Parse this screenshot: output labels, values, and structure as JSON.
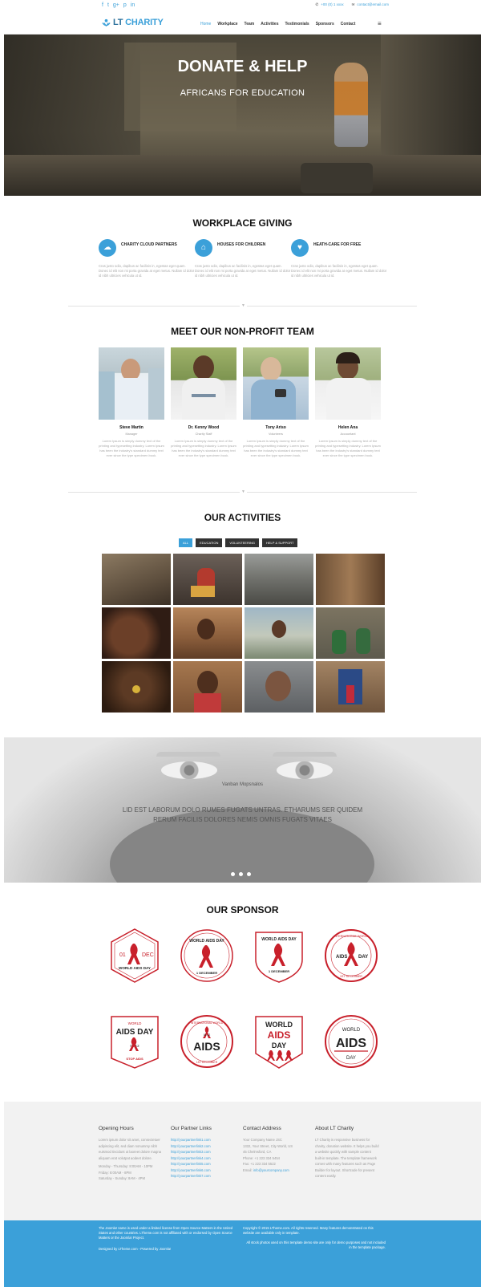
{
  "topbar": {
    "social_icons": [
      "facebook-icon",
      "twitter-icon",
      "google-plus-icon",
      "pinterest-icon",
      "linkedin-icon"
    ],
    "phone": "+00 (0) 1 xxxx",
    "email": "contact@email.com"
  },
  "header": {
    "logo_lt": "LT",
    "logo_charity": "CHARITY",
    "nav": [
      "Home",
      "Workplace",
      "Team",
      "Activities",
      "Testimonials",
      "Sponsors",
      "Contact"
    ]
  },
  "hero": {
    "title": "DONATE & HELP",
    "subtitle": "AFRICANS FOR EDUCATION"
  },
  "workplace": {
    "title": "WORKPLACE GIVING",
    "items": [
      {
        "heading": "CHARITY CLOUD PARTNERS",
        "icon": "cloud-icon",
        "text": "Cras justo odio, dapibus ac facilisis in, egestas eget quam. Donec id elit non mi porta gravida at eget metus. Nullam id dolor id nibh ultricies vehicula ut id."
      },
      {
        "heading": "HOUSES FOR CHILDREN",
        "icon": "home-icon",
        "text": "Cras justo odio, dapibus ac facilisis in, egestas eget quam. Donec id elit non mi porta gravida at eget metus. Nullam id dolor id nibh ultricies vehicula ut id."
      },
      {
        "heading": "HEATH-CARE FOR FREE",
        "icon": "heart-icon",
        "text": "Cras justo odio, dapibus ac facilisis in, egestas eget quam. Donec id elit non mi porta gravida at eget metus. Nullam id dolor id nibh ultricies vehicula ut id."
      }
    ]
  },
  "team": {
    "title": "MEET OUR NON-PROFIT TEAM",
    "members": [
      {
        "name": "Steve Martin",
        "role": "Manager",
        "bio": "Lorem Ipsum is simply dummy text of the printing and typesetting industry. Lorem Ipsum has been the industry's standard dummy text ever since the type specimen book."
      },
      {
        "name": "Dr. Kenny Wood",
        "role": "Charity Staff",
        "bio": "Lorem Ipsum is simply dummy text of the printing and typesetting industry. Lorem Ipsum has been the industry's standard dummy text ever since the type specimen book."
      },
      {
        "name": "Tony Ariso",
        "role": "Volunteers",
        "bio": "Lorem Ipsum is simply dummy text of the printing and typesetting industry. Lorem Ipsum has been the industry's standard dummy text ever since the type specimen book."
      },
      {
        "name": "Helen Ana",
        "role": "Accountant",
        "bio": "Lorem Ipsum is simply dummy text of the printing and typesetting industry. Lorem Ipsum has been the industry's standard dummy text ever since the type specimen book."
      }
    ]
  },
  "activities": {
    "title": "OUR ACTIVITIES",
    "filters": [
      "ALL",
      "EDUCATION",
      "VOLUNTEERING",
      "HELP & SUPPORT"
    ],
    "gallery_count": 12
  },
  "testimonial": {
    "author": "Vanban Mopsnalos",
    "quote": "LID EST LABORUM DOLO RUMES FUGATS UNTRAS. ETHARUMS SER QUIDEM RERUM FACILIS DOLORES NEMIS OMNIS FUGATS VITAES"
  },
  "sponsors": {
    "title": "OUR SPONSOR",
    "badges": [
      {
        "line1": "01",
        "line2": "DEC",
        "line3": "WORLD AIDS DAY"
      },
      {
        "line1": "WORLD AIDS DAY",
        "line2": "1 DECEMBER"
      },
      {
        "line1": "WORLD AIDS DAY",
        "line2": "1 DECEMBER"
      },
      {
        "line1": "AIDS",
        "line2": "DAY",
        "line3": "1ST DECEMBER",
        "line4": "INTERNATIONAL WORLD"
      },
      {
        "line1": "WORLD",
        "line2": "AIDS DAY",
        "line3": "01 12",
        "line4": "STOP AIDS"
      },
      {
        "line1": "AIDS",
        "line2": "INTERNATIONAL WORLD",
        "line3": "1ST DECEMBER",
        "line4": "01 12"
      },
      {
        "line1": "WORLD",
        "line2": "AIDS",
        "line3": "DAY"
      },
      {
        "line1": "WORLD",
        "line2": "AIDS",
        "line3": "DAY"
      }
    ],
    "red": "#c8202b"
  },
  "footer": {
    "opening": {
      "title": "Opening Hours",
      "text": "Lorem ipsum dolor sit amet, consectetuer adipiscing elit, sed diam nonummy nibh euismod tincidunt ut laoreet dolore magna aliquam erat volutpat aodeet dolore.",
      "hours": [
        "Monday - Thursday: 8:00AM - 10PM",
        "Friday: 8:00AM - 8PM",
        "Saturday - Sunday: 8AM - 4PM"
      ]
    },
    "partners": {
      "title": "Our Partner Links",
      "links": [
        "http://yourpartnerlink1.com",
        "http://yourpartnerlink2.com",
        "http://yourpartnerlink3.com",
        "http://yourpartnerlink4.com",
        "http://yourpartnerlink5.com",
        "http://yourpartnerlink6.com",
        "http://yourpartnerlink7.com"
      ]
    },
    "contact": {
      "title": "Contact Address",
      "lines": [
        "Your Company Name JSC",
        "1332, Your Street, City World, US",
        "45 Chelmsford, CA",
        "Phone: +1 223 334 5454",
        "Fax: +1 223 334 5522"
      ],
      "email_label": "Email: ",
      "email": "info@yourcompany.com"
    },
    "about": {
      "title": "About LT Charity",
      "text": "LT Charity is responsive business for charity, donation website. It helps you build a website quickly with sample content built-in template. The template framework comes with many features such as Page Builder for layout. Shortcode for present content easily."
    },
    "bottom_left": "The Joomla! name is used under a limited license from Open Source Matters in the United States and other countries. LTheme.com is not affiliated with or endorsed by Open Source Matters or the Joomla! Project.",
    "bottom_left2": "Designed by LTheme.com - Powered by Joomla!",
    "bottom_right": "Copyright © 2015 LTheme.com. All rights reserved. Many features demonstrated on this website are available only in template.",
    "bottom_right2": "All stock photos used on this template demo site are only for demo purposes and not included in the template package."
  },
  "colors": {
    "accent": "#3ba0d9",
    "dark": "#333333"
  }
}
